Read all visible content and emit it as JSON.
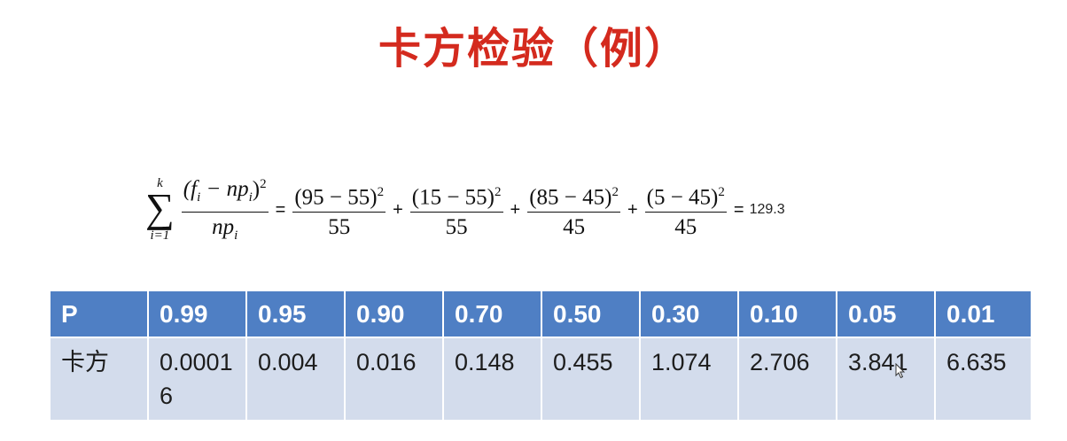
{
  "slide": {
    "title": "卡方检验（例）"
  },
  "formula": {
    "sum_upper": "k",
    "sum_lower": "i=1",
    "sigma": "∑",
    "general_num": "(f",
    "general_num_sub": "i",
    "general_num_mid": " − np",
    "general_num_sub2": "i",
    "general_num_close": ")",
    "general_num_sup": "2",
    "general_den": "np",
    "general_den_sub": "i",
    "eq": "=",
    "terms": [
      {
        "num": "(95 − 55)",
        "sup": "2",
        "den": "55"
      },
      {
        "num": "(15 − 55)",
        "sup": "2",
        "den": "55"
      },
      {
        "num": "(85 − 45)",
        "sup": "2",
        "den": "45"
      },
      {
        "num": "(5 − 45)",
        "sup": "2",
        "den": "45"
      }
    ],
    "plus": "+",
    "result": "129.3"
  },
  "table": {
    "header": [
      "P",
      "0.99",
      "0.95",
      "0.90",
      "0.70",
      "0.50",
      "0.30",
      "0.10",
      "0.05",
      "0.01"
    ],
    "row": [
      "卡方",
      "0.00016",
      "0.004",
      "0.016",
      "0.148",
      "0.455",
      "1.074",
      "2.706",
      "3.841",
      "6.635"
    ]
  },
  "colors": {
    "title": "#d42a1e",
    "header_bg": "#4f7fc4",
    "cell_bg": "#d3dcec"
  },
  "icons": {
    "cursor": "mouse-pointer-icon"
  }
}
